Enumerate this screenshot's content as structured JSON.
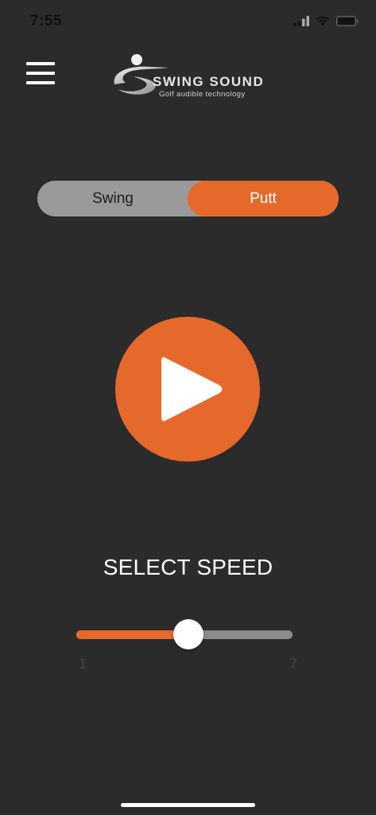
{
  "status_bar": {
    "time": "7:55",
    "icons": [
      "cellular-signal-icon",
      "wifi-icon",
      "battery-icon"
    ]
  },
  "header": {
    "menu_icon": "hamburger-menu-icon",
    "logo_title": "SWING SOUND",
    "logo_subtitle": "Golf audible technology"
  },
  "mode_selector": {
    "options": [
      "Swing",
      "Putt"
    ],
    "selected": "Putt"
  },
  "player": {
    "play_icon": "play-icon"
  },
  "speed": {
    "title": "SELECT SPEED",
    "min_label": "1",
    "max_label": "7",
    "value_fraction": 0.52
  },
  "colors": {
    "background": "#2b2b2b",
    "accent": "#e5692a",
    "inactive": "#9a9a9a",
    "text": "#ffffff"
  }
}
